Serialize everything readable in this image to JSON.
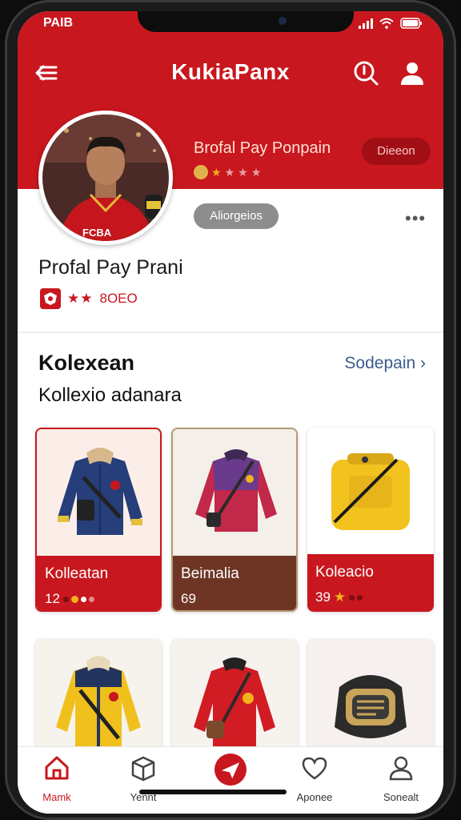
{
  "status_bar": {
    "time": "PAIB"
  },
  "app": {
    "title": "KukiaPanx"
  },
  "header": {
    "name": "Brofal Pay Ponpain",
    "follow_label": "Dieeon",
    "tag_label": "Aliorgeios",
    "more_label": "•••"
  },
  "profile": {
    "name": "Profal Pay Prani",
    "stars": "★★",
    "count": "8OEO"
  },
  "section": {
    "title": "Kolexean",
    "link": "Sodepain ›",
    "subtitle": "Kollexio adanara"
  },
  "cards": [
    {
      "label": "Kolleatan",
      "value": "12",
      "color": "#c8171e"
    },
    {
      "label": "Beimalia",
      "value": "69",
      "color": "#6f3524"
    },
    {
      "label": "Koleacio",
      "value": "39",
      "color": "#c8171e"
    }
  ],
  "tabs": [
    {
      "label": "Mamk",
      "icon": "home-icon"
    },
    {
      "label": "Yennt",
      "icon": "box-icon"
    },
    {
      "label": "",
      "icon": "plane-icon"
    },
    {
      "label": "Aponee",
      "icon": "heart-icon"
    },
    {
      "label": "Sonealt",
      "icon": "person-icon"
    }
  ],
  "colors": {
    "brand_red": "#c8171e",
    "brown": "#6f3524",
    "link_blue": "#3a5b8c"
  }
}
